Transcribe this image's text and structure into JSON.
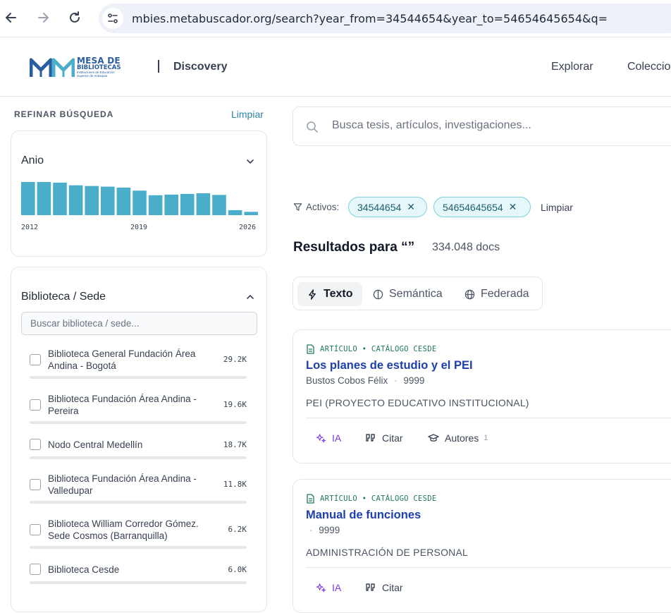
{
  "browser": {
    "url": "mbies.metabuscador.org/search?year_from=34544654&year_to=54654645654&q="
  },
  "header": {
    "logo_line1": "MESA DE",
    "logo_line2": "BIBLIOTECAS",
    "logo_line3": "Instituciones de Educación Superior de Antioquia",
    "product": "Discovery",
    "nav": [
      "Explorar",
      "Coleccio"
    ]
  },
  "sidebar": {
    "title": "REFINAR BÚSQUEDA",
    "clear": "Limpiar",
    "year_facet": {
      "title": "Anio",
      "ticks": [
        "2012",
        "2019",
        "2026"
      ],
      "bars": [
        1.0,
        1.0,
        0.98,
        0.9,
        0.88,
        0.86,
        0.83,
        0.74,
        0.6,
        0.62,
        0.64,
        0.66,
        0.61,
        0.15,
        0.1
      ]
    },
    "library_facet": {
      "title": "Biblioteca / Sede",
      "search_placeholder": "Buscar biblioteca / sede...",
      "items": [
        {
          "name": "Biblioteca General Fundación Área Andina - Bogotá",
          "count": "29.2K"
        },
        {
          "name": "Biblioteca Fundación Área Andina - Pereira",
          "count": "19.6K"
        },
        {
          "name": "Nodo Central Medellín",
          "count": "18.7K"
        },
        {
          "name": "Biblioteca Fundación Área Andina - Valledupar",
          "count": "11.8K"
        },
        {
          "name": "Biblioteca William Corredor Gómez. Sede Cosmos (Barranquilla)",
          "count": "6.2K"
        },
        {
          "name": "Biblioteca Cesde",
          "count": "6.0K"
        }
      ]
    }
  },
  "main": {
    "search_placeholder": "Busca tesis, artículos, investigaciones...",
    "active_label": "Activos:",
    "chips": [
      "34544654",
      "54654645654"
    ],
    "active_clear": "Limpiar",
    "results_title": "Resultados para “”",
    "results_count": "334.048 docs",
    "modes": [
      "Texto",
      "Semántica",
      "Federada"
    ],
    "results": [
      {
        "type": "ARTÍCULO • CATÁLOGO CESDE",
        "title": "Los planes de estudio y el PEI",
        "author": "Bustos Cobos Félix",
        "sep": "·",
        "year": "9999",
        "subject": "PEI (PROYECTO EDUCATIVO INSTITUCIONAL)",
        "actions": {
          "ia": "IA",
          "cite": "Citar",
          "authors": "Autores",
          "authors_count": "1"
        }
      },
      {
        "type": "ARTÍCULO • CATÁLOGO CESDE",
        "title": "Manual de funciones",
        "author": "",
        "sep": "·",
        "year": "9999",
        "subject": "ADMINISTRACIÓN DE PERSONAL",
        "actions": {
          "ia": "IA",
          "cite": "Citar"
        }
      }
    ]
  },
  "colors": {
    "accent": "#2a87a8",
    "bar": "#4aaecb",
    "chip_bg": "#e6f7fa",
    "title_link": "#1e40af",
    "ia": "#7c3aed",
    "type_green": "#1f7a55"
  }
}
